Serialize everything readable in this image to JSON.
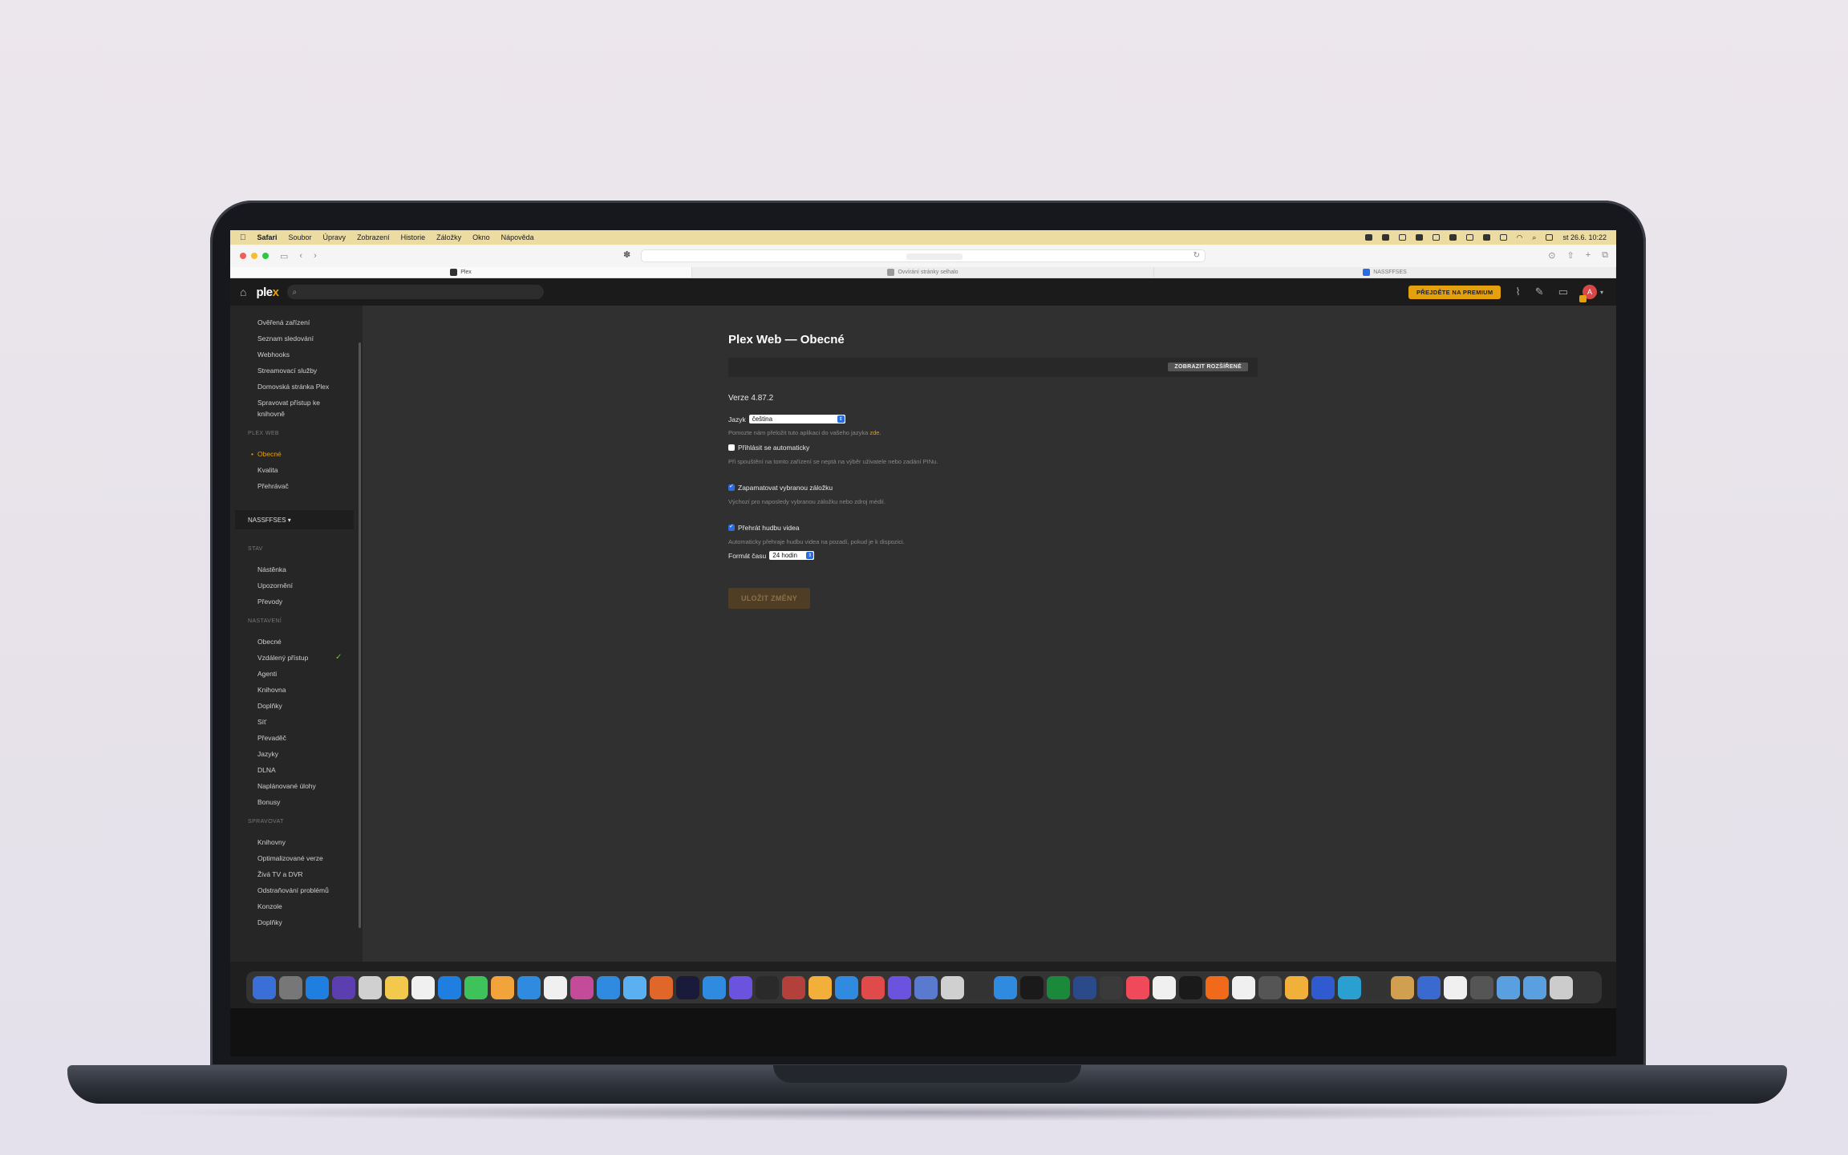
{
  "menubar": {
    "apple": "",
    "items": [
      "Safari",
      "Soubor",
      "Úpravy",
      "Zobrazení",
      "Historie",
      "Záložky",
      "Okno",
      "Nápověda"
    ],
    "clock": "st 26.6. 10:22"
  },
  "browser": {
    "tabs": [
      {
        "label": "Plex"
      },
      {
        "label": "Ovvírání stránky selhalo"
      },
      {
        "label": "NASSFFSES"
      }
    ]
  },
  "header": {
    "logo_main": "ple",
    "logo_x": "x",
    "premium_label": "PŘEJDĚTE NA PREMIUM",
    "avatar_initial": "A"
  },
  "sidebar": {
    "top_items": [
      "Ověřená zařízení",
      "Seznam sledování",
      "Webhooks",
      "Streamovací služby",
      "Domovská stránka Plex",
      "Spravovat přístup ke",
      "knihovně"
    ],
    "plex_web_section": "PLEX WEB",
    "plex_web_items": [
      "Obecné",
      "Kvalita",
      "Přehrávač"
    ],
    "server_name": "NASSFFSES ▾",
    "status_section": "STAV",
    "status_items": [
      "Nástěnka",
      "Upozornění",
      "Převody"
    ],
    "settings_section": "NASTAVENÍ",
    "settings_items": [
      "Obecné",
      "Vzdálený přístup",
      "Agenti",
      "Knihovna",
      "Doplňky",
      "Síť",
      "Převaděč",
      "Jazyky",
      "DLNA",
      "Naplánované úlohy",
      "Bonusy"
    ],
    "manage_section": "SPRAVOVAT",
    "manage_items": [
      "Knihovny",
      "Optimalizované verze",
      "Živá TV a DVR",
      "Odstraňování problémů",
      "Konzole",
      "Doplňky"
    ]
  },
  "main": {
    "title": "Plex Web — Obecné",
    "advanced_button": "ZOBRAZIT ROZŠÍŘENÉ",
    "version": "Verze 4.87.2",
    "language_label": "Jazyk",
    "language_value": "čeština",
    "language_hint": "Pomozte nám přeložit tuto aplikaci do vašeho jazyka",
    "language_hint_link": "zde.",
    "auto_signin_label": "Přihlásit se automaticky",
    "auto_signin_checked": false,
    "auto_signin_hint": "Při spouštění na tomto zařízení se neptá na výběr uživatele nebo zadání PINu.",
    "remember_tab_label": "Zapamatovat vybranou záložku",
    "remember_tab_checked": true,
    "remember_tab_hint": "Výchozí pro naposledy vybranou záložku nebo zdroj médií.",
    "theme_music_label": "Přehrát hudbu videa",
    "theme_music_checked": true,
    "theme_music_hint": "Automaticky přehraje hudbu videa na pozadí, pokud je k dispozici.",
    "time_format_label": "Formát času",
    "time_format_value": "24 hodin",
    "save_label": "ULOŽIT ZMĚNY"
  },
  "colors": {
    "accent": "#e5a00d",
    "menubar": "#ecdca2",
    "sidebar_bg": "#262626",
    "main_bg": "#303030",
    "check": "#7cbf4a"
  },
  "dock": {
    "icon_colors": [
      "#3b6fd8",
      "#777777",
      "#1f7fe0",
      "#5b3fb0",
      "#d0d0d0",
      "#f2c94c",
      "#f0f0f0",
      "#1f7fe0",
      "#3ec35a",
      "#f2a43a",
      "#2f8be0",
      "#f0f0f0",
      "#c44b9a",
      "#2f8be0",
      "#5ab0f0",
      "#e0662a",
      "#1a1a3a",
      "#2f8be0",
      "#6b53e0",
      "#2a2a2a",
      "#b3403a",
      "#f2b03a",
      "#2f8be0",
      "#e04a4a",
      "#6b53e0",
      "#5a7ad0",
      "#d0d0d0",
      "#333333",
      "#2f8be0",
      "#1a1a1a",
      "#1a8a3a",
      "#2a4a8a",
      "#3a3a3a",
      "#f04a5a",
      "#f0f0f0",
      "#1a1a1a",
      "#f06a1a",
      "#f0f0f0",
      "#555555",
      "#f0b03a",
      "#2f5ad0",
      "#2aa0d0",
      "#333333",
      "#d0a050",
      "#3a6ad0",
      "#f0f0f0",
      "#555555",
      "#5aa0e0",
      "#5aa0e0",
      "#cccccc"
    ]
  }
}
